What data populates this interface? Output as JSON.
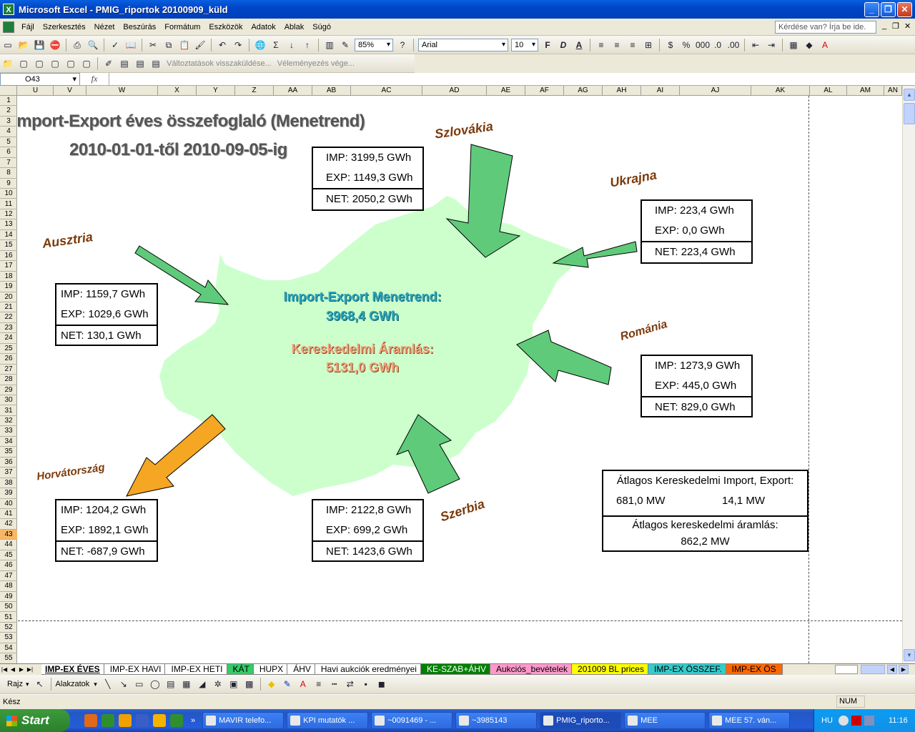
{
  "window": {
    "title": "Microsoft Excel - PMIG_riportok 20100909_küld",
    "minimize": "_",
    "maximize": "❐",
    "close": "✕"
  },
  "menu": [
    "Fájl",
    "Szerkesztés",
    "Nézet",
    "Beszúrás",
    "Formátum",
    "Eszközök",
    "Adatok",
    "Ablak",
    "Súgó"
  ],
  "help_placeholder": "Kérdése van? Írja be ide.",
  "toolbar": {
    "zoom": "85%",
    "font": "Arial",
    "font_size": "10",
    "review_send": "Változtatások visszaküldése...",
    "review_end": "Véleményezés vége..."
  },
  "formula": {
    "name_box": "O43",
    "fx": "fx",
    "value": ""
  },
  "columns": [
    "U",
    "V",
    "W",
    "X",
    "Y",
    "Z",
    "AA",
    "AB",
    "AC",
    "AD",
    "AE",
    "AF",
    "AG",
    "AH",
    "AI",
    "AJ",
    "AK",
    "AL",
    "AM",
    "AN"
  ],
  "rows": [
    "1",
    "2",
    "3",
    "4",
    "5",
    "6",
    "7",
    "8",
    "9",
    "10",
    "11",
    "12",
    "13",
    "14",
    "15",
    "16",
    "17",
    "18",
    "19",
    "20",
    "21",
    "22",
    "23",
    "24",
    "25",
    "26",
    "27",
    "28",
    "29",
    "30",
    "31",
    "32",
    "33",
    "34",
    "35",
    "36",
    "37",
    "38",
    "39",
    "40",
    "41",
    "42",
    "43",
    "44",
    "45",
    "46",
    "47",
    "48",
    "49",
    "50",
    "51",
    "52",
    "53",
    "54",
    "55"
  ],
  "active_row": "43",
  "map": {
    "title_line1": "Import-Export éves összefoglaló (Menetrend)",
    "title_line2": "2010-01-01-től 2010-09-05-ig",
    "center": {
      "menetrend_label": "Import-Export Menetrend:",
      "menetrend_value": "3968,4 GWh",
      "aramlas_label": "Kereskedelmi Áramlás:",
      "aramlas_value": "5131,0 GWh"
    },
    "countries": {
      "slovakia": {
        "name": "Szlovákia",
        "imp": "3199,5 GWh",
        "exp": "1149,3 GWh",
        "net": "2050,2 GWh"
      },
      "ukraine": {
        "name": "Ukrajna",
        "imp": "223,4 GWh",
        "exp": "0,0 GWh",
        "net": "223,4 GWh"
      },
      "austria": {
        "name": "Ausztria",
        "imp": "1159,7 GWh",
        "exp": "1029,6 GWh",
        "net": "130,1 GWh"
      },
      "romania": {
        "name": "Románia",
        "imp": "1273,9 GWh",
        "exp": "445,0 GWh",
        "net": "829,0 GWh"
      },
      "croatia": {
        "name": "Horvátország",
        "imp": "1204,2 GWh",
        "exp": "1892,1 GWh",
        "net": "-687,9 GWh"
      },
      "serbia": {
        "name": "Szerbia",
        "imp": "2122,8 GWh",
        "exp": "699,2 GWh",
        "net": "1423,6 GWh"
      }
    },
    "labels": {
      "imp": "IMP:",
      "exp": "EXP:",
      "net": "NET:"
    },
    "average": {
      "import_export_label": "Átlagos Kereskedelmi Import, Export:",
      "import_value": "681,0 MW",
      "export_value": "14,1 MW",
      "flow_label": "Átlagos kereskedelmi áramlás:",
      "flow_value": "862,2 MW"
    },
    "colors": {
      "land": "#CCFFCC",
      "arrow_in": "#5FCB7A",
      "arrow_out": "#F5A623"
    }
  },
  "sheet_tabs": [
    {
      "label": "IMP-EX ÉVES",
      "color": "#FFFFFF"
    },
    {
      "label": "IMP-EX HAVI",
      "color": "#FFFFFF"
    },
    {
      "label": "IMP-EX HETI",
      "color": "#FFFFFF"
    },
    {
      "label": "KÁT",
      "color": "#33CC66"
    },
    {
      "label": "HUPX",
      "color": "#FFFFFF"
    },
    {
      "label": "ÁHV",
      "color": "#FFFFFF"
    },
    {
      "label": "Havi aukciók eredményei",
      "color": "#FFFFFF"
    },
    {
      "label": "KE-SZAB+ÁHV",
      "color": "#008000"
    },
    {
      "label": "Aukciós_bevételek",
      "color": "#FF99CC"
    },
    {
      "label": "201009 BL prices",
      "color": "#FFFF00"
    },
    {
      "label": "IMP-EX ÖSSZEF.",
      "color": "#33CCCC"
    },
    {
      "label": "IMP-EX ÖS",
      "color": "#FF6600"
    }
  ],
  "drawbar": {
    "draw": "Rajz",
    "shapes": "Alakzatok"
  },
  "status": {
    "left": "Kész",
    "num": "NUM"
  },
  "taskbar": {
    "start": "Start",
    "tasks": [
      "MAVIR telefo...",
      "KPI mutatók ...",
      "~0091469 - ...",
      "~3985143",
      "PMIG_riporto...",
      "MEE",
      "MEE 57. ván..."
    ],
    "active_task": "PMIG_riporto...",
    "lang": "HU",
    "clock": "11:16"
  }
}
